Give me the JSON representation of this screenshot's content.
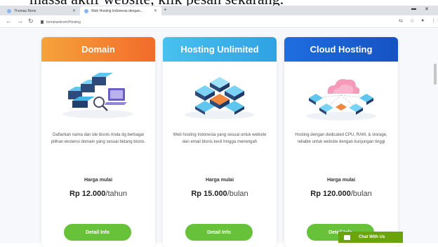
{
  "caption": "massa aktif website, klik pesan sekarang.",
  "browser": {
    "tabs": [
      {
        "label": "Thomas Rene"
      },
      {
        "label": "Web Hosting Indonesia dengan..."
      }
    ],
    "url": "tomahardcom/Hosting"
  },
  "cards": [
    {
      "title": "Domain",
      "color": "#f47b2b",
      "description": "Daftarkan nama dan ide bisnis Anda dg berbagai pilihan ekstensi domain yang sesuai bidang bisnis.",
      "price_label": "Harga mulai",
      "price_amount": "Rp 12.000",
      "price_unit": "/tahun",
      "button": "Detail Info"
    },
    {
      "title": "Hosting Unlimited",
      "color": "#3bb4ea",
      "description": "Web hosting Indonesia yang sesuai untuk website dan email bisnis kecil hingga menengah",
      "price_label": "Harga mulai",
      "price_amount": "Rp 15.000",
      "price_unit": "/bulan",
      "button": "Detail Info"
    },
    {
      "title": "Cloud Hosting",
      "color": "#1a5fd0",
      "description": "Hosting dengan dedicated CPU, RAM, & storage, reliable untuk website dengan kunjungan tinggi",
      "price_label": "Harga mulai",
      "price_amount": "Rp 120.000",
      "price_unit": "/bulan",
      "button": "Detail Info"
    }
  ],
  "chat": {
    "label": "Chat With Us"
  }
}
